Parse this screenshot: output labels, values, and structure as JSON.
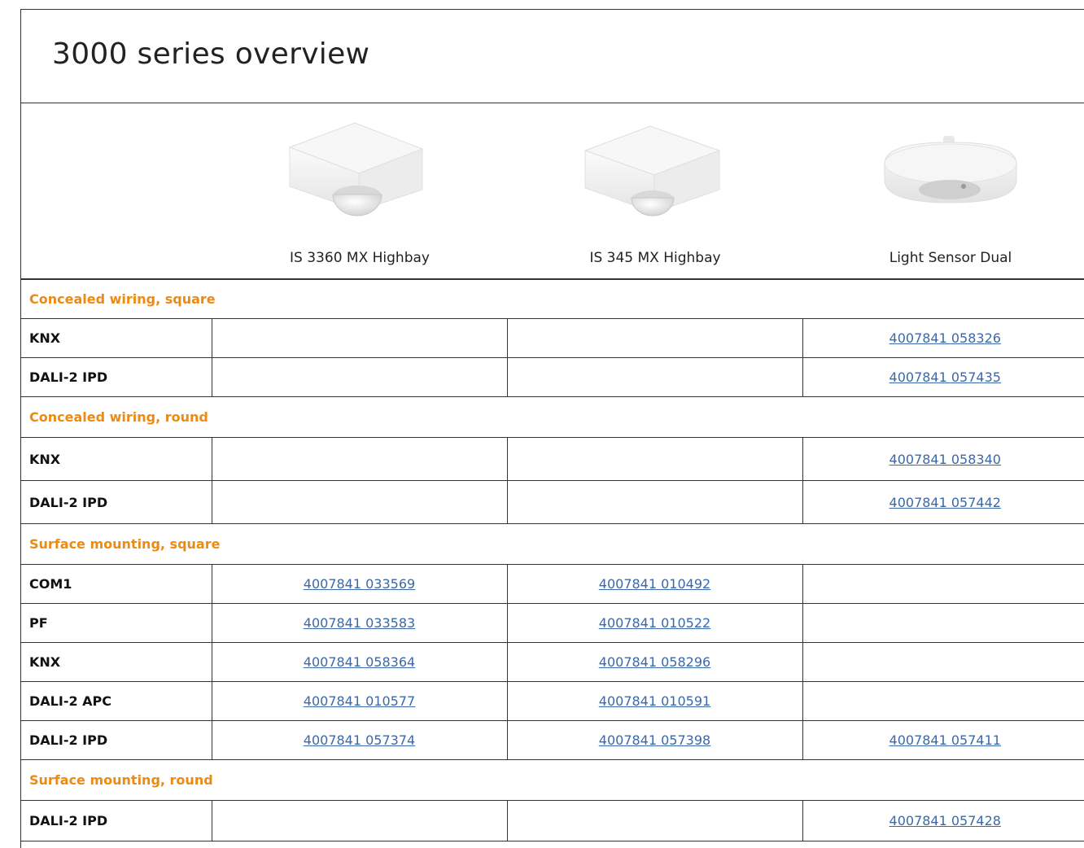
{
  "title": "3000 series overview",
  "products": [
    {
      "name": "IS 3360 MX Highbay",
      "image": "square-sensor-large-dome"
    },
    {
      "name": "IS 345 MX Highbay",
      "image": "square-sensor-small-dome"
    },
    {
      "name": "Light Sensor Dual",
      "image": "round-light-sensor"
    }
  ],
  "sections": [
    {
      "heading": "Concealed wiring, square",
      "rows": [
        {
          "label": "KNX",
          "cells": [
            "",
            "",
            "4007841 058326"
          ]
        },
        {
          "label": "DALI-2 IPD",
          "cells": [
            "",
            "",
            "4007841 057435"
          ]
        }
      ]
    },
    {
      "heading": "Concealed wiring, round",
      "rows": [
        {
          "label": "KNX",
          "cells": [
            "",
            "",
            "4007841 058340"
          ]
        },
        {
          "label": "DALI-2 IPD",
          "cells": [
            "",
            "",
            "4007841 057442"
          ]
        }
      ]
    },
    {
      "heading": "Surface mounting, square",
      "rows": [
        {
          "label": "COM1",
          "cells": [
            "4007841 033569",
            "4007841 010492",
            ""
          ]
        },
        {
          "label": "PF",
          "cells": [
            "4007841 033583",
            "4007841 010522",
            ""
          ]
        },
        {
          "label": "KNX",
          "cells": [
            "4007841 058364",
            "4007841 058296",
            ""
          ]
        },
        {
          "label": "DALI-2 APC",
          "cells": [
            "4007841 010577",
            "4007841 010591",
            ""
          ]
        },
        {
          "label": "DALI-2 IPD",
          "cells": [
            "4007841 057374",
            "4007841 057398",
            "4007841 057411"
          ]
        }
      ]
    },
    {
      "heading": "Surface mounting, round",
      "rows": [
        {
          "label": "DALI-2 IPD",
          "cells": [
            "",
            "",
            "4007841 057428"
          ]
        }
      ]
    }
  ],
  "colors": {
    "section_heading": "#ee8a12",
    "link": "#3a68a8",
    "border": "#333333"
  }
}
